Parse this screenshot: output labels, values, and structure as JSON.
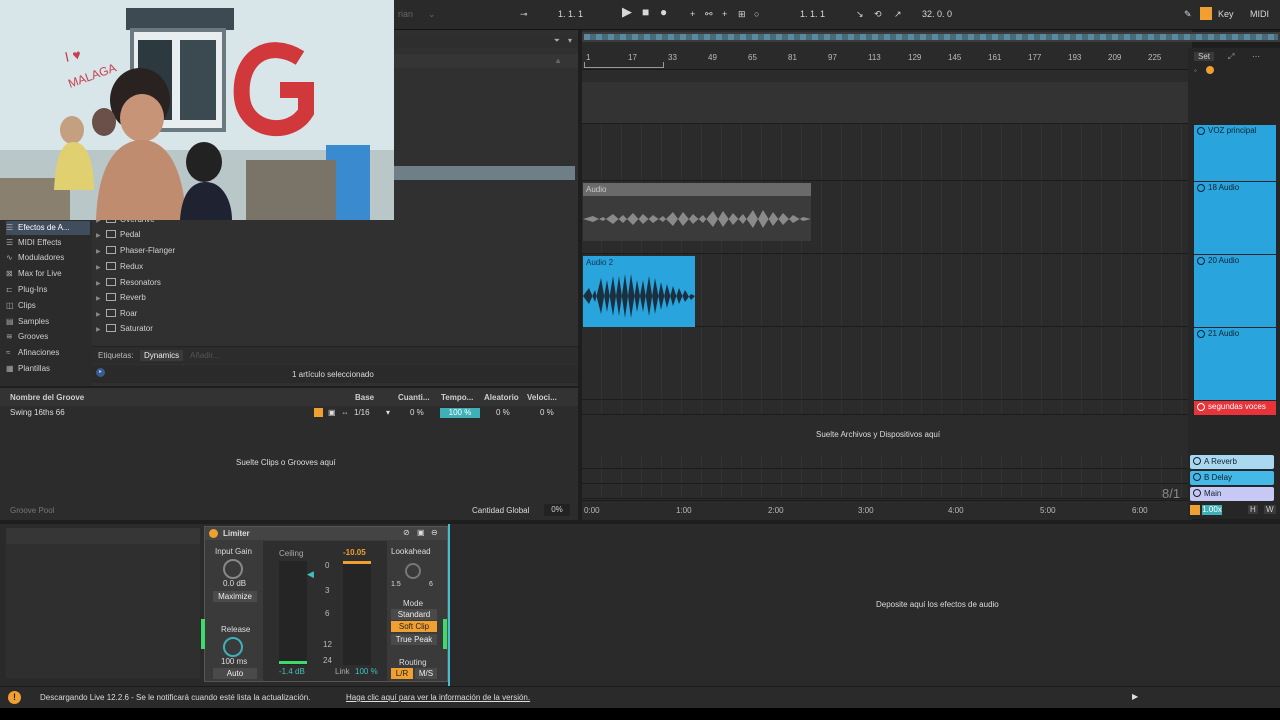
{
  "transport": {
    "position": "1. 1. 1",
    "loop_start": "1. 1. 1",
    "loop_length": "32. 0. 0",
    "key_label": "Key",
    "midi_label": "MIDI",
    "input_hint": "rian"
  },
  "browser": {
    "categories": [
      {
        "label": "Efectos de A...",
        "icon": "audio-effects-icon"
      },
      {
        "label": "MIDI Effects",
        "icon": "midi-effects-icon"
      },
      {
        "label": "Moduladores",
        "icon": "modulators-icon"
      },
      {
        "label": "Max for Live",
        "icon": "max-for-live-icon"
      },
      {
        "label": "Plug-Ins",
        "icon": "plugins-icon"
      },
      {
        "label": "Clips",
        "icon": "clips-icon"
      },
      {
        "label": "Samples",
        "icon": "samples-icon"
      },
      {
        "label": "Grooves",
        "icon": "grooves-icon"
      },
      {
        "label": "Afinaciones",
        "icon": "tunings-icon"
      },
      {
        "label": "Plantillas",
        "icon": "templates-icon"
      }
    ],
    "items": [
      "Overdrive",
      "Pedal",
      "Phaser-Flanger",
      "Redux",
      "Resonators",
      "Reverb",
      "Roar",
      "Saturator"
    ],
    "tags_label": "Etiquetas:",
    "tag": "Dynamics",
    "tag_add": "Añadir...",
    "status": "1 artículo seleccionado"
  },
  "groove_pool": {
    "headers": [
      "Nombre del Groove",
      "Base",
      "Cuanti...",
      "Tempo...",
      "Aleatorio",
      "Veloci..."
    ],
    "row": {
      "name": "Swing 16ths 66",
      "base": "1/16",
      "quantize": "0 %",
      "timing": "100 %",
      "random": "0 %",
      "velocity": "0 %"
    },
    "drop_hint": "Suelte Clips o Grooves aquí",
    "footer_label": "Groove Pool",
    "global_label": "Cantidad Global",
    "global_value": "0%"
  },
  "arrangement": {
    "ruler": [
      "1",
      "17",
      "33",
      "49",
      "65",
      "81",
      "97",
      "113",
      "129",
      "145",
      "161",
      "177",
      "193",
      "209",
      "225"
    ],
    "time": [
      "0:00",
      "1:00",
      "2:00",
      "3:00",
      "4:00",
      "5:00",
      "6:00"
    ],
    "clips": [
      {
        "label": "Audio",
        "color": "#6a6a6a"
      },
      {
        "label": "Audio 2",
        "color": "#29a4dc"
      }
    ],
    "drop_hint": "Suelte Archivos y Dispositivos aquí",
    "set_label": "Set",
    "signature": "8/1",
    "zoom": "1.00x",
    "h_label": "H",
    "w_label": "W"
  },
  "tracks": [
    {
      "name": "VOZ principal",
      "color": "#29a4dc"
    },
    {
      "name": "18 Audio",
      "color": "#29a4dc"
    },
    {
      "name": "20 Audio",
      "color": "#29a4dc"
    },
    {
      "name": "21 Audio",
      "color": "#29a4dc"
    },
    {
      "name": "segundas voces",
      "color": "#e8333a"
    }
  ],
  "returns": [
    {
      "name": "A Reverb",
      "color": "#a9d8f0"
    },
    {
      "name": "B Delay",
      "color": "#44b8e6"
    },
    {
      "name": "Main",
      "color": "#c8c8f5"
    }
  ],
  "limiter": {
    "title": "Limiter",
    "input_gain_label": "Input Gain",
    "input_gain_value": "0.0 dB",
    "maximize_label": "Maximize",
    "release_label": "Release",
    "release_value": "100 ms",
    "auto_label": "Auto",
    "ceiling_label": "Ceiling",
    "ceiling_value": "-1.4 dB",
    "gr_value": "-10.05",
    "scale": [
      "0",
      "3",
      "6",
      "12",
      "24"
    ],
    "link_label": "Link",
    "link_value": "100 %",
    "lookahead_label": "Lookahead",
    "lookahead_min": "1.5",
    "lookahead_max": "6",
    "mode_label": "Mode",
    "modes": [
      "Standard",
      "Soft Clip",
      "True Peak"
    ],
    "routing_label": "Routing",
    "routing": [
      "L/R",
      "M/S"
    ]
  },
  "device_drop_hint": "Deposite aquí los efectos de audio",
  "status_bar": {
    "text": "Descargando Live 12.2.6 - Se le notificará cuando esté lista la actualización.",
    "link": "Haga clic aquí para ver la información de la versión."
  },
  "webcam": {
    "graffiti": "I ♥ MALAGA",
    "graffiti_letter": "G"
  },
  "colors": {
    "accent": "#29a4dc",
    "orange": "#f0a030",
    "red": "#e8333a",
    "teal": "#40b0b8",
    "green": "#3ddc6a"
  }
}
